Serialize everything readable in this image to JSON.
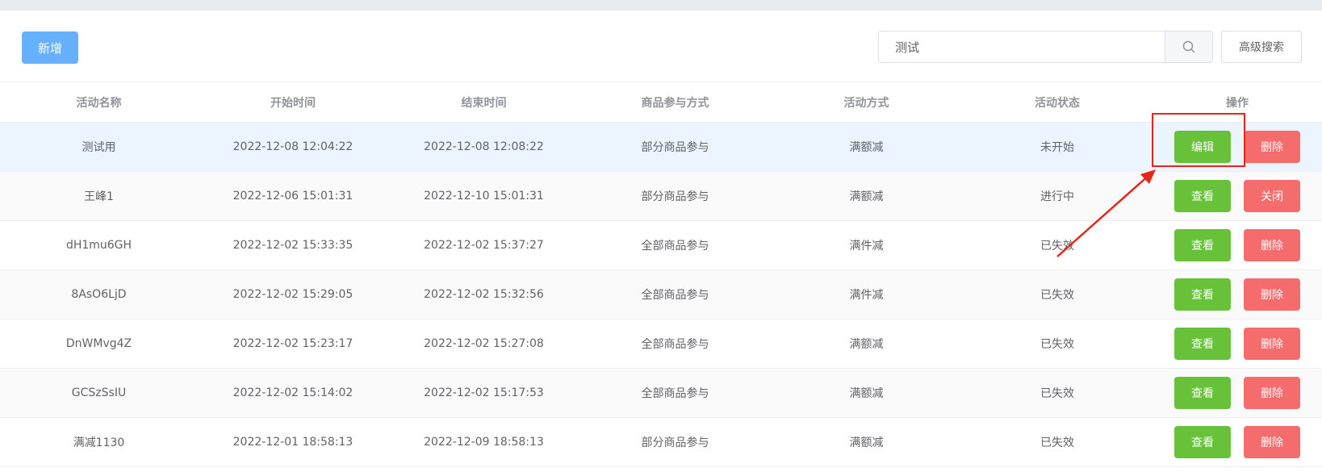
{
  "toolbar": {
    "add_label": "新增",
    "search_value": "测试",
    "advanced_search_label": "高级搜索"
  },
  "table": {
    "headers": [
      "活动名称",
      "开始时间",
      "结束时间",
      "商品参与方式",
      "活动方式",
      "活动状态",
      "操作"
    ],
    "rows": [
      {
        "name": "测试用",
        "start": "2022-12-08 12:04:22",
        "end": "2022-12-08 12:08:22",
        "participation": "部分商品参与",
        "method": "满额减",
        "status": "未开始",
        "primary_action": "编辑",
        "secondary_action": "删除"
      },
      {
        "name": "王峰1",
        "start": "2022-12-06 15:01:31",
        "end": "2022-12-10 15:01:31",
        "participation": "部分商品参与",
        "method": "满额减",
        "status": "进行中",
        "primary_action": "查看",
        "secondary_action": "关闭"
      },
      {
        "name": "dH1mu6GH",
        "start": "2022-12-02 15:33:35",
        "end": "2022-12-02 15:37:27",
        "participation": "全部商品参与",
        "method": "满件减",
        "status": "已失效",
        "primary_action": "查看",
        "secondary_action": "删除"
      },
      {
        "name": "8AsO6LjD",
        "start": "2022-12-02 15:29:05",
        "end": "2022-12-02 15:32:56",
        "participation": "全部商品参与",
        "method": "满件减",
        "status": "已失效",
        "primary_action": "查看",
        "secondary_action": "删除"
      },
      {
        "name": "DnWMvg4Z",
        "start": "2022-12-02 15:23:17",
        "end": "2022-12-02 15:27:08",
        "participation": "全部商品参与",
        "method": "满额减",
        "status": "已失效",
        "primary_action": "查看",
        "secondary_action": "删除"
      },
      {
        "name": "GCSzSsIU",
        "start": "2022-12-02 15:14:02",
        "end": "2022-12-02 15:17:53",
        "participation": "全部商品参与",
        "method": "满额减",
        "status": "已失效",
        "primary_action": "查看",
        "secondary_action": "删除"
      },
      {
        "name": "满减1130",
        "start": "2022-12-01 18:58:13",
        "end": "2022-12-09 18:58:13",
        "participation": "部分商品参与",
        "method": "满额减",
        "status": "已失效",
        "primary_action": "查看",
        "secondary_action": "删除"
      }
    ]
  },
  "colors": {
    "primary_blue": "#66b1ff",
    "success_green": "#67c23a",
    "danger_red": "#f56c6c",
    "annotation_red": "#e8241b"
  },
  "icons": {
    "search": "search-icon"
  }
}
